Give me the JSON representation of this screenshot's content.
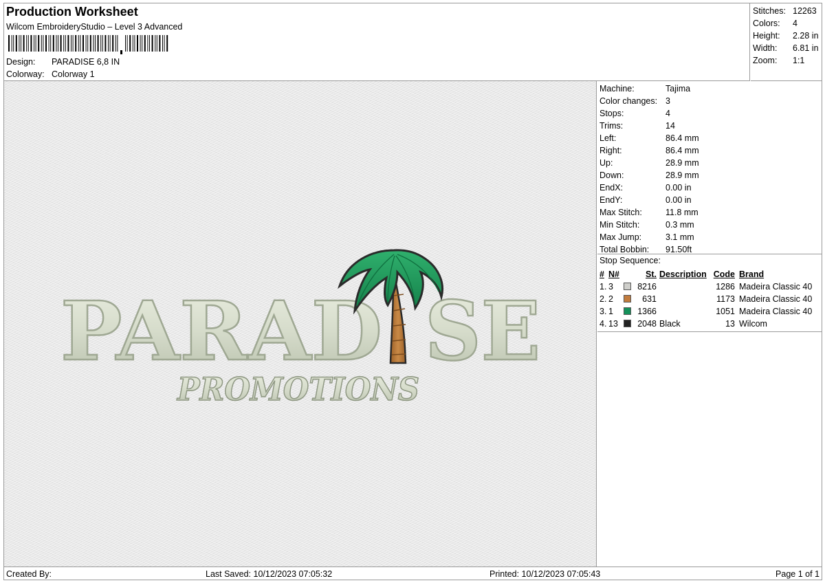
{
  "header": {
    "title": "Production Worksheet",
    "subtitle": "Wilcom EmbroideryStudio – Level 3 Advanced",
    "design_label": "Design:",
    "design_value": "PARADISE 6,8 IN",
    "colorway_label": "Colorway:",
    "colorway_value": "Colorway 1"
  },
  "summary": [
    {
      "label": "Stitches:",
      "value": "12263"
    },
    {
      "label": "Colors:",
      "value": "4"
    },
    {
      "label": "Height:",
      "value": "2.28 in"
    },
    {
      "label": "Width:",
      "value": "6.81 in"
    },
    {
      "label": "Zoom:",
      "value": "1:1"
    }
  ],
  "machine_info": [
    {
      "label": "Machine:",
      "value": "Tajima"
    },
    {
      "label": "Color changes:",
      "value": "3"
    },
    {
      "label": "Stops:",
      "value": "4"
    },
    {
      "label": "Trims:",
      "value": "14"
    },
    {
      "label": "Left:",
      "value": "86.4 mm"
    },
    {
      "label": "Right:",
      "value": "86.4 mm"
    },
    {
      "label": "Up:",
      "value": "28.9 mm"
    },
    {
      "label": "Down:",
      "value": "28.9 mm"
    },
    {
      "label": "EndX:",
      "value": "0.00 in"
    },
    {
      "label": "EndY:",
      "value": "0.00 in"
    },
    {
      "label": "Max Stitch:",
      "value": "11.8 mm"
    },
    {
      "label": "Min Stitch:",
      "value": "0.3 mm"
    },
    {
      "label": "Max Jump:",
      "value": "3.1 mm"
    },
    {
      "label": "Total Bobbin:",
      "value": "91.50ft"
    }
  ],
  "stop_sequence": {
    "title": "Stop Sequence:",
    "headers": {
      "num": "#",
      "n": "N#",
      "st": "St.",
      "description": "Description",
      "code": "Code",
      "brand": "Brand"
    },
    "rows": [
      {
        "num": "1.",
        "n": "3",
        "color": "#cfcfcb",
        "st": "8216",
        "description": "",
        "code": "1286",
        "brand": "Madeira Classic 40"
      },
      {
        "num": "2.",
        "n": "2",
        "color": "#c27c3e",
        "st": "631",
        "description": "",
        "code": "1173",
        "brand": "Madeira Classic 40"
      },
      {
        "num": "3.",
        "n": "1",
        "color": "#14915a",
        "st": "1366",
        "description": "",
        "code": "1051",
        "brand": "Madeira Classic 40"
      },
      {
        "num": "4.",
        "n": "13",
        "color": "#222222",
        "st": "2048",
        "description": "Black",
        "code": "13",
        "brand": "Wilcom"
      }
    ]
  },
  "design_preview": {
    "main_text": "PARAD",
    "main_text_end": "SE",
    "sub_text": "PROMOTIONS",
    "thread_colors": {
      "letters": "#d6dccb",
      "outline": "#9fa893",
      "trunk": "#b87838",
      "leaves": "#1e9a5a",
      "black": "#2a2a2a"
    }
  },
  "footer": {
    "created_by": "Created By:",
    "last_saved": "Last Saved: 10/12/2023 07:05:32",
    "printed": "Printed: 10/12/2023 07:05:43",
    "page": "Page 1 of 1"
  }
}
